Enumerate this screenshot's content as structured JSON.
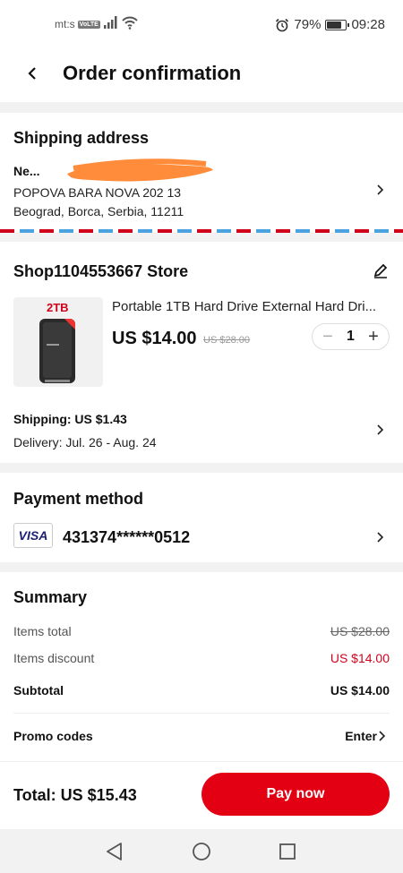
{
  "status": {
    "carrier": "mt:s",
    "volte": "VoLTE",
    "battery_pct": "79%",
    "battery_level": 0.79,
    "time": "09:28"
  },
  "header": {
    "title": "Order confirmation"
  },
  "shipping": {
    "title": "Shipping address",
    "name": "Ne...",
    "line1": "POPOVA BARA NOVA 202 13",
    "line2": "Beograd, Borca, Serbia, 11211"
  },
  "store": {
    "name": "Shop1104553667 Store",
    "product": {
      "badge": "2TB",
      "name": "Portable 1TB Hard Drive External Hard Dri...",
      "price": "US $14.00",
      "old_price": "US $28.00",
      "quantity": "1"
    },
    "shipping_cost": "Shipping: US $1.43",
    "delivery": "Delivery: Jul. 26 - Aug. 24"
  },
  "payment": {
    "title": "Payment method",
    "card_brand": "VISA",
    "card_number": "431374******0512"
  },
  "summary": {
    "title": "Summary",
    "items_total_label": "Items total",
    "items_total": "US $28.00",
    "discount_label": "Items discount",
    "discount": "US $14.00",
    "subtotal_label": "Subtotal",
    "subtotal": "US $14.00",
    "promo_label": "Promo codes",
    "promo_action": "Enter"
  },
  "footer": {
    "total": "Total:  US $15.43",
    "pay_label": "Pay now"
  },
  "colors": {
    "accent": "#e30012",
    "discount": "#d0021b"
  }
}
